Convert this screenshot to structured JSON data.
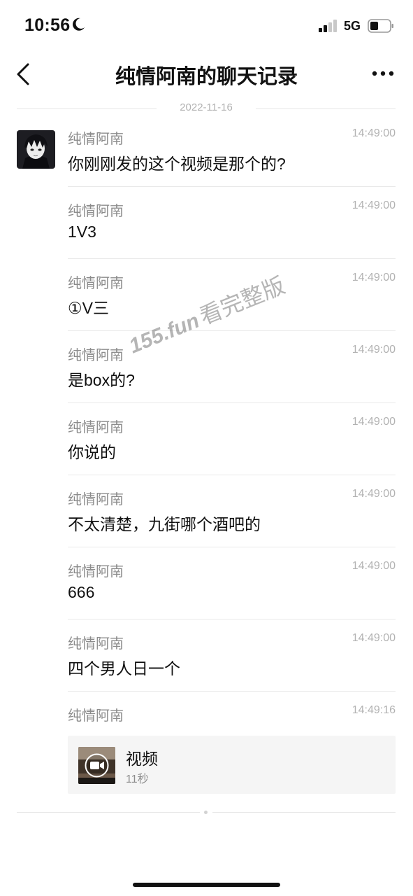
{
  "status_bar": {
    "time": "10:56",
    "network": "5G"
  },
  "nav": {
    "title": "纯情阿南的聊天记录"
  },
  "date_separator": "2022-11-16",
  "messages": [
    {
      "sender": "纯情阿南",
      "time": "14:49:00",
      "text": "你刚刚发的这个视频是那个的?"
    },
    {
      "sender": "纯情阿南",
      "time": "14:49:00",
      "text": "1V3"
    },
    {
      "sender": "纯情阿南",
      "time": "14:49:00",
      "text": "①V三"
    },
    {
      "sender": "纯情阿南",
      "time": "14:49:00",
      "text": "是box的?"
    },
    {
      "sender": "纯情阿南",
      "time": "14:49:00",
      "text": "你说的"
    },
    {
      "sender": "纯情阿南",
      "time": "14:49:00",
      "text": "不太清楚，九街哪个酒吧的"
    },
    {
      "sender": "纯情阿南",
      "time": "14:49:00",
      "text": "666"
    },
    {
      "sender": "纯情阿南",
      "time": "14:49:00",
      "text": "四个男人日一个"
    },
    {
      "sender": "纯情阿南",
      "time": "14:49:16",
      "video": {
        "title": "视频",
        "duration": "11秒"
      }
    }
  ],
  "watermark": {
    "site": "155.fun",
    "text": "看完整版"
  },
  "icons": {
    "back": "chevron-left-icon",
    "more": "more-dots-icon",
    "moon": "moon-icon",
    "signal": "signal-icon",
    "battery": "battery-icon",
    "video_play": "video-camera-icon"
  }
}
